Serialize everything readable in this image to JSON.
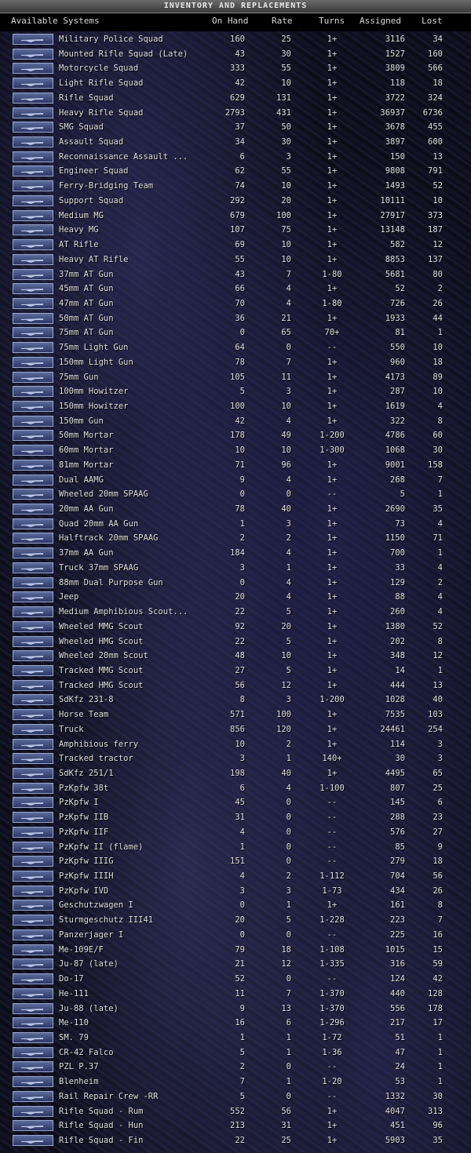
{
  "window_title": "INVENTORY AND REPLACEMENTS",
  "columns": {
    "name": "Available Systems",
    "on_hand": "On Hand",
    "rate": "Rate",
    "turns": "Turns",
    "assigned": "Assigned",
    "lost": "Lost"
  },
  "rows": [
    {
      "name": "Military Police Squad",
      "on_hand": "160",
      "rate": "25",
      "turns": "1+",
      "assigned": "3116",
      "lost": "34"
    },
    {
      "name": "Mounted Rifle Squad (Late)",
      "on_hand": "43",
      "rate": "30",
      "turns": "1+",
      "assigned": "1527",
      "lost": "160"
    },
    {
      "name": "Motorcycle Squad",
      "on_hand": "333",
      "rate": "55",
      "turns": "1+",
      "assigned": "3809",
      "lost": "566"
    },
    {
      "name": "Light Rifle Squad",
      "on_hand": "42",
      "rate": "10",
      "turns": "1+",
      "assigned": "118",
      "lost": "18"
    },
    {
      "name": "Rifle Squad",
      "on_hand": "629",
      "rate": "131",
      "turns": "1+",
      "assigned": "3722",
      "lost": "324"
    },
    {
      "name": "Heavy Rifle Squad",
      "on_hand": "2793",
      "rate": "431",
      "turns": "1+",
      "assigned": "36937",
      "lost": "6736"
    },
    {
      "name": "SMG Squad",
      "on_hand": "37",
      "rate": "50",
      "turns": "1+",
      "assigned": "3678",
      "lost": "455"
    },
    {
      "name": "Assault Squad",
      "on_hand": "34",
      "rate": "30",
      "turns": "1+",
      "assigned": "3897",
      "lost": "600"
    },
    {
      "name": "Reconnaissance Assault ...",
      "on_hand": "6",
      "rate": "3",
      "turns": "1+",
      "assigned": "150",
      "lost": "13"
    },
    {
      "name": "Engineer Squad",
      "on_hand": "62",
      "rate": "55",
      "turns": "1+",
      "assigned": "9808",
      "lost": "791"
    },
    {
      "name": "Ferry-Bridging Team",
      "on_hand": "74",
      "rate": "10",
      "turns": "1+",
      "assigned": "1493",
      "lost": "52"
    },
    {
      "name": "Support Squad",
      "on_hand": "292",
      "rate": "20",
      "turns": "1+",
      "assigned": "10111",
      "lost": "10"
    },
    {
      "name": "Medium MG",
      "on_hand": "679",
      "rate": "100",
      "turns": "1+",
      "assigned": "27917",
      "lost": "373"
    },
    {
      "name": "Heavy MG",
      "on_hand": "107",
      "rate": "75",
      "turns": "1+",
      "assigned": "13148",
      "lost": "187"
    },
    {
      "name": "AT Rifle",
      "on_hand": "69",
      "rate": "10",
      "turns": "1+",
      "assigned": "582",
      "lost": "12"
    },
    {
      "name": "Heavy AT Rifle",
      "on_hand": "55",
      "rate": "10",
      "turns": "1+",
      "assigned": "8853",
      "lost": "137"
    },
    {
      "name": "37mm AT Gun",
      "on_hand": "43",
      "rate": "7",
      "turns": "1-80",
      "assigned": "5681",
      "lost": "80"
    },
    {
      "name": "45mm AT Gun",
      "on_hand": "66",
      "rate": "4",
      "turns": "1+",
      "assigned": "52",
      "lost": "2"
    },
    {
      "name": "47mm AT Gun",
      "on_hand": "70",
      "rate": "4",
      "turns": "1-80",
      "assigned": "726",
      "lost": "26"
    },
    {
      "name": "50mm AT Gun",
      "on_hand": "36",
      "rate": "21",
      "turns": "1+",
      "assigned": "1933",
      "lost": "44"
    },
    {
      "name": "75mm AT Gun",
      "on_hand": "0",
      "rate": "65",
      "turns": "70+",
      "assigned": "81",
      "lost": "1"
    },
    {
      "name": "75mm Light Gun",
      "on_hand": "64",
      "rate": "0",
      "turns": "--",
      "assigned": "550",
      "lost": "10"
    },
    {
      "name": "150mm Light Gun",
      "on_hand": "78",
      "rate": "7",
      "turns": "1+",
      "assigned": "960",
      "lost": "18"
    },
    {
      "name": "75mm Gun",
      "on_hand": "105",
      "rate": "11",
      "turns": "1+",
      "assigned": "4173",
      "lost": "89"
    },
    {
      "name": "100mm Howitzer",
      "on_hand": "5",
      "rate": "3",
      "turns": "1+",
      "assigned": "287",
      "lost": "10"
    },
    {
      "name": "150mm Howitzer",
      "on_hand": "100",
      "rate": "10",
      "turns": "1+",
      "assigned": "1619",
      "lost": "4"
    },
    {
      "name": "150mm Gun",
      "on_hand": "42",
      "rate": "4",
      "turns": "1+",
      "assigned": "322",
      "lost": "8"
    },
    {
      "name": "50mm Mortar",
      "on_hand": "178",
      "rate": "49",
      "turns": "1-200",
      "assigned": "4786",
      "lost": "60"
    },
    {
      "name": "60mm Mortar",
      "on_hand": "10",
      "rate": "10",
      "turns": "1-300",
      "assigned": "1068",
      "lost": "30"
    },
    {
      "name": "81mm Mortar",
      "on_hand": "71",
      "rate": "96",
      "turns": "1+",
      "assigned": "9001",
      "lost": "158"
    },
    {
      "name": "Dual AAMG",
      "on_hand": "9",
      "rate": "4",
      "turns": "1+",
      "assigned": "268",
      "lost": "7"
    },
    {
      "name": "Wheeled 20mm SPAAG",
      "on_hand": "0",
      "rate": "0",
      "turns": "--",
      "assigned": "5",
      "lost": "1"
    },
    {
      "name": "20mm AA Gun",
      "on_hand": "78",
      "rate": "40",
      "turns": "1+",
      "assigned": "2690",
      "lost": "35"
    },
    {
      "name": "Quad 20mm AA Gun",
      "on_hand": "1",
      "rate": "3",
      "turns": "1+",
      "assigned": "73",
      "lost": "4"
    },
    {
      "name": "Halftrack 20mm SPAAG",
      "on_hand": "2",
      "rate": "2",
      "turns": "1+",
      "assigned": "1150",
      "lost": "71"
    },
    {
      "name": "37mm AA Gun",
      "on_hand": "184",
      "rate": "4",
      "turns": "1+",
      "assigned": "700",
      "lost": "1"
    },
    {
      "name": "Truck 37mm SPAAG",
      "on_hand": "3",
      "rate": "1",
      "turns": "1+",
      "assigned": "33",
      "lost": "4"
    },
    {
      "name": "88mm Dual Purpose Gun",
      "on_hand": "0",
      "rate": "4",
      "turns": "1+",
      "assigned": "129",
      "lost": "2"
    },
    {
      "name": "Jeep",
      "on_hand": "20",
      "rate": "4",
      "turns": "1+",
      "assigned": "88",
      "lost": "4"
    },
    {
      "name": "Medium Amphibious Scout...",
      "on_hand": "22",
      "rate": "5",
      "turns": "1+",
      "assigned": "260",
      "lost": "4"
    },
    {
      "name": "Wheeled MMG Scout",
      "on_hand": "92",
      "rate": "20",
      "turns": "1+",
      "assigned": "1380",
      "lost": "52"
    },
    {
      "name": "Wheeled HMG Scout",
      "on_hand": "22",
      "rate": "5",
      "turns": "1+",
      "assigned": "202",
      "lost": "8"
    },
    {
      "name": "Wheeled 20mm Scout",
      "on_hand": "48",
      "rate": "10",
      "turns": "1+",
      "assigned": "348",
      "lost": "12"
    },
    {
      "name": "Tracked MMG Scout",
      "on_hand": "27",
      "rate": "5",
      "turns": "1+",
      "assigned": "14",
      "lost": "1"
    },
    {
      "name": "Tracked HMG Scout",
      "on_hand": "56",
      "rate": "12",
      "turns": "1+",
      "assigned": "444",
      "lost": "13"
    },
    {
      "name": "SdKfz 231-8",
      "on_hand": "8",
      "rate": "3",
      "turns": "1-200",
      "assigned": "1028",
      "lost": "40"
    },
    {
      "name": "Horse Team",
      "on_hand": "571",
      "rate": "100",
      "turns": "1+",
      "assigned": "7535",
      "lost": "103"
    },
    {
      "name": "Truck",
      "on_hand": "856",
      "rate": "120",
      "turns": "1+",
      "assigned": "24461",
      "lost": "254"
    },
    {
      "name": "Amphibious ferry",
      "on_hand": "10",
      "rate": "2",
      "turns": "1+",
      "assigned": "114",
      "lost": "3"
    },
    {
      "name": "Tracked tractor",
      "on_hand": "3",
      "rate": "1",
      "turns": "140+",
      "assigned": "30",
      "lost": "3"
    },
    {
      "name": "SdKfz 251/1",
      "on_hand": "198",
      "rate": "40",
      "turns": "1+",
      "assigned": "4495",
      "lost": "65"
    },
    {
      "name": "PzKpfw 38t",
      "on_hand": "6",
      "rate": "4",
      "turns": "1-100",
      "assigned": "807",
      "lost": "25"
    },
    {
      "name": "PzKpfw I",
      "on_hand": "45",
      "rate": "0",
      "turns": "--",
      "assigned": "145",
      "lost": "6"
    },
    {
      "name": "PzKpfw IIB",
      "on_hand": "31",
      "rate": "0",
      "turns": "--",
      "assigned": "288",
      "lost": "23"
    },
    {
      "name": "PzKpfw IIF",
      "on_hand": "4",
      "rate": "0",
      "turns": "--",
      "assigned": "576",
      "lost": "27"
    },
    {
      "name": "PzKpfw II (flame)",
      "on_hand": "1",
      "rate": "0",
      "turns": "--",
      "assigned": "85",
      "lost": "9"
    },
    {
      "name": "PzKpfw IIIG",
      "on_hand": "151",
      "rate": "0",
      "turns": "--",
      "assigned": "279",
      "lost": "18"
    },
    {
      "name": "PzKpfw IIIH",
      "on_hand": "4",
      "rate": "2",
      "turns": "1-112",
      "assigned": "704",
      "lost": "56"
    },
    {
      "name": "PzKpfw IVD",
      "on_hand": "3",
      "rate": "3",
      "turns": "1-73",
      "assigned": "434",
      "lost": "26"
    },
    {
      "name": "Geschutzwagen I",
      "on_hand": "0",
      "rate": "1",
      "turns": "1+",
      "assigned": "161",
      "lost": "8"
    },
    {
      "name": "Sturmgeschutz III41",
      "on_hand": "20",
      "rate": "5",
      "turns": "1-228",
      "assigned": "223",
      "lost": "7"
    },
    {
      "name": "Panzerjager I",
      "on_hand": "0",
      "rate": "0",
      "turns": "--",
      "assigned": "225",
      "lost": "16"
    },
    {
      "name": "Me-109E/F",
      "on_hand": "79",
      "rate": "18",
      "turns": "1-108",
      "assigned": "1015",
      "lost": "15"
    },
    {
      "name": "Ju-87 (late)",
      "on_hand": "21",
      "rate": "12",
      "turns": "1-335",
      "assigned": "316",
      "lost": "59"
    },
    {
      "name": "Do-17",
      "on_hand": "52",
      "rate": "0",
      "turns": "--",
      "assigned": "124",
      "lost": "42"
    },
    {
      "name": "He-111",
      "on_hand": "11",
      "rate": "7",
      "turns": "1-370",
      "assigned": "440",
      "lost": "128"
    },
    {
      "name": "Ju-88 (late)",
      "on_hand": "9",
      "rate": "13",
      "turns": "1-370",
      "assigned": "556",
      "lost": "178"
    },
    {
      "name": "Me-110",
      "on_hand": "16",
      "rate": "6",
      "turns": "1-296",
      "assigned": "217",
      "lost": "17"
    },
    {
      "name": "SM. 79",
      "on_hand": "1",
      "rate": "1",
      "turns": "1-72",
      "assigned": "51",
      "lost": "1"
    },
    {
      "name": "CR-42 Falco",
      "on_hand": "5",
      "rate": "1",
      "turns": "1-36",
      "assigned": "47",
      "lost": "1"
    },
    {
      "name": "PZL P.37",
      "on_hand": "2",
      "rate": "0",
      "turns": "--",
      "assigned": "24",
      "lost": "1"
    },
    {
      "name": "Blenheim",
      "on_hand": "7",
      "rate": "1",
      "turns": "1-20",
      "assigned": "53",
      "lost": "1"
    },
    {
      "name": "Rail Repair Crew -RR",
      "on_hand": "5",
      "rate": "0",
      "turns": "--",
      "assigned": "1332",
      "lost": "30"
    },
    {
      "name": "Rifle Squad - Rum",
      "on_hand": "552",
      "rate": "56",
      "turns": "1+",
      "assigned": "4047",
      "lost": "313"
    },
    {
      "name": "Rifle Squad - Hun",
      "on_hand": "213",
      "rate": "31",
      "turns": "1+",
      "assigned": "451",
      "lost": "96"
    },
    {
      "name": "Rifle Squad - Fin",
      "on_hand": "22",
      "rate": "25",
      "turns": "1+",
      "assigned": "5903",
      "lost": "35"
    }
  ]
}
